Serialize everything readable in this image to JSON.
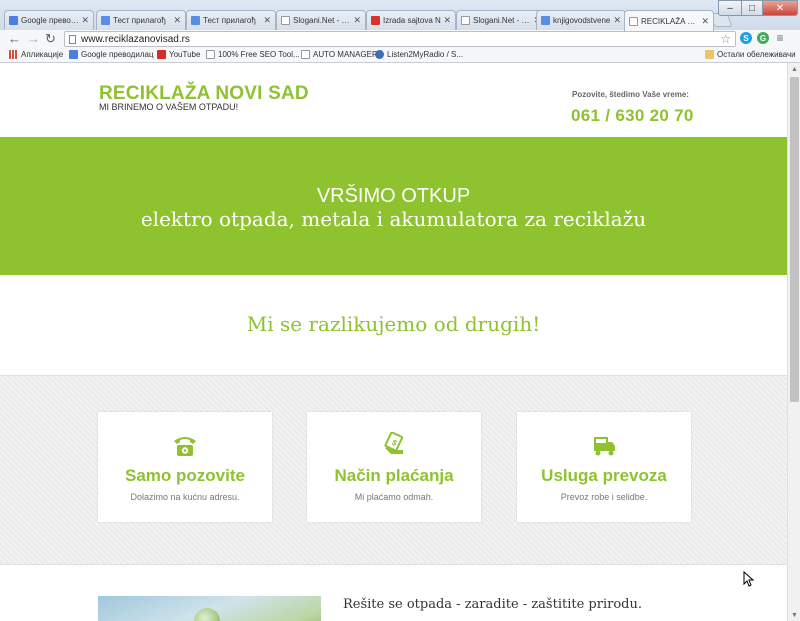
{
  "browser": {
    "tabs": [
      {
        "title": "Google преводи",
        "favicon_color": "#4a7fe0"
      },
      {
        "title": "Тест прилагођ",
        "favicon_color": "#5a8de6"
      },
      {
        "title": "Тест прилагођ",
        "favicon_color": "#5a8de6"
      },
      {
        "title": "Slogani.Net - Da",
        "favicon_color": "#ffffff"
      },
      {
        "title": "Izrada sajtova N",
        "favicon_color": "#d9342b"
      },
      {
        "title": "Slogani.Net - Da",
        "favicon_color": "#ffffff"
      },
      {
        "title": "knjigovodstvene",
        "favicon_color": "#5a8de6"
      },
      {
        "title": "RECIKLAŽA NOV",
        "favicon_color": "#ffffff",
        "active": true
      }
    ],
    "tab_close": "✕",
    "window_minimize": "–",
    "window_maximize": "□",
    "window_close": "✕",
    "back": "←",
    "forward": "→",
    "reload": "↻",
    "url": "www.reciklazanovisad.rs",
    "star": "☆",
    "menu": "≡",
    "extensions": [
      {
        "letter": "S",
        "color": "#1fa0e4"
      },
      {
        "letter": "G",
        "color": "#3fae5a"
      },
      {
        "letter": "C",
        "color": "#888888"
      }
    ],
    "bookmarks": [
      {
        "label": "Апликације",
        "color": "#d34c3b"
      },
      {
        "label": "Google преводилац",
        "color": "#4a7fe0"
      },
      {
        "label": "YouTube",
        "color": "#d12d2d"
      },
      {
        "label": "100% Free SEO Tool...",
        "color": "#ffffff"
      },
      {
        "label": "AUTO MANAGER",
        "color": "#ffffff"
      },
      {
        "label": "Listen2MyRadio / S...",
        "color": "#3d6db3"
      }
    ],
    "other_bookmarks": "Остали обележивачи"
  },
  "site": {
    "logo": "RECIKLAŽA NOVI SAD",
    "tagline": "MI BRINEMO O VAŠEM OTPADU!",
    "call_label": "Pozovite, štedimo Vaše vreme:",
    "phone": "061 / 630 20 70",
    "accent": "#8ec22e",
    "hero_line1": "VRŠIMO OTKUP",
    "hero_line2": "elektro otpada, metala i akumulatora za reciklažu",
    "differ_title": "Mi se razlikujemo od drugih!",
    "features": [
      {
        "icon": "phone-icon",
        "title": "Samo pozovite",
        "subtitle": "Dolazimo na kućnu adresu."
      },
      {
        "icon": "payment-icon",
        "title": "Način plaćanja",
        "subtitle": "Mi plaćamo odmah."
      },
      {
        "icon": "truck-icon",
        "title": "Usluga prevoza",
        "subtitle": "Prevoz robe i selidbe."
      }
    ],
    "bottom_text": "Rešite se otpada - zaradite - zaštitite prirodu."
  }
}
